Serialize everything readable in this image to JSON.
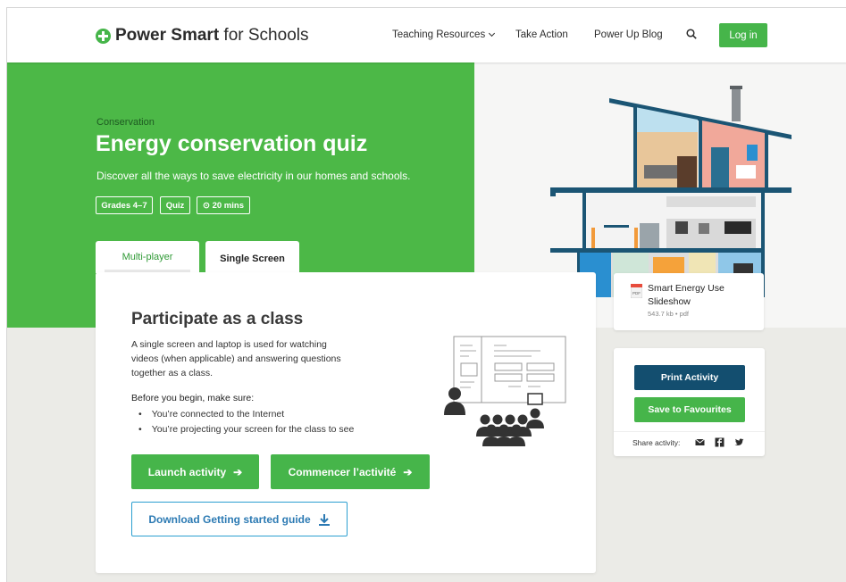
{
  "header": {
    "logo_bold": "Power Smart",
    "logo_rest": " for Schools",
    "nav": [
      {
        "label": "Teaching Resources"
      },
      {
        "label": "Take Action"
      },
      {
        "label": "Power Up Blog"
      }
    ],
    "login_label": "Log in"
  },
  "hero": {
    "eyebrow": "Conservation",
    "title": "Energy conservation quiz",
    "subtitle": "Discover all the ways to save electricity in our homes and schools.",
    "tags": [
      "Grades 4–7",
      "Quiz",
      "⊙ 20 mins"
    ]
  },
  "tabs": [
    {
      "label": "Multi-player",
      "active": false
    },
    {
      "label": "Single Screen",
      "active": true
    }
  ],
  "card": {
    "title": "Participate as a class",
    "description": "A single screen and laptop is used for watching videos (when applicable) and answering questions together as a class.",
    "before_label": "Before you begin, make sure:",
    "checklist": [
      "You’re connected to the Internet",
      "You’re projecting your screen for the class to see"
    ],
    "launch_label": "Launch activity",
    "launch_fr_label": "Commencer l’activité",
    "download_label": "Download Getting started guide"
  },
  "file": {
    "name": "Smart Energy Use Slideshow",
    "meta": "543.7 kb • pdf",
    "icon_text": "PDF"
  },
  "actions": {
    "print_label": "Print Activity",
    "favourites_label": "Save to Favourites",
    "share_label": "Share activity:"
  },
  "colors": {
    "brand_green": "#46b54a",
    "hero_green": "#4cb847",
    "navy": "#134e6f",
    "link_blue": "#2c9fd0"
  }
}
